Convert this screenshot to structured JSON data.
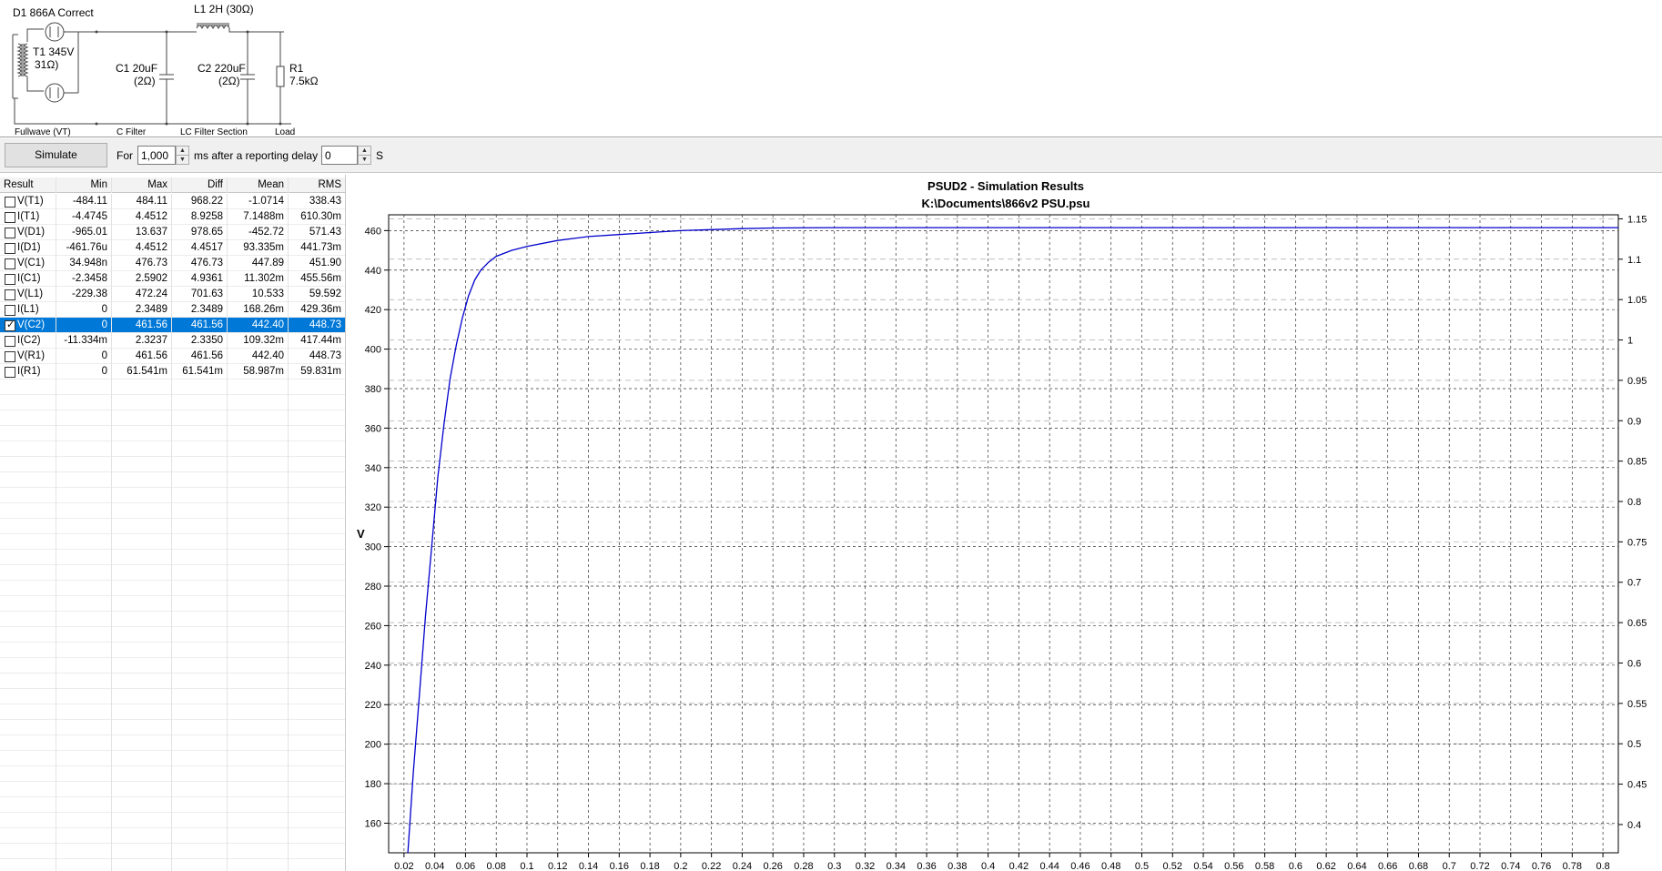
{
  "schematic": {
    "labels": {
      "d1": "D1 866A Correct",
      "l1": "L1 2H (30Ω)",
      "t1_line1": "T1 345V",
      "t1_line2": "31Ω)",
      "c1_line1": "C1 20uF",
      "c1_line2": "(2Ω)",
      "c2_line1": "C2 220uF",
      "c2_line2": "(2Ω)",
      "r1_line1": "R1",
      "r1_line2": "7.5kΩ"
    },
    "sections": {
      "fullwave": "Fullwave (VT)",
      "cfilter": "C Filter",
      "lcfilter": "LC Filter Section",
      "load": "Load"
    }
  },
  "toolbar": {
    "simulate_label": "Simulate",
    "for_label": "For",
    "duration_value": "1,000",
    "ms_label": "ms  after a reporting delay of",
    "delay_value": "0",
    "s_label": "S"
  },
  "results": {
    "headers": [
      "Result",
      "Min",
      "Max",
      "Diff",
      "Mean",
      "RMS"
    ],
    "rows": [
      {
        "name": "V(T1)",
        "min": "-484.11",
        "max": "484.11",
        "diff": "968.22",
        "mean": "-1.0714",
        "rms": "338.43",
        "checked": false
      },
      {
        "name": "I(T1)",
        "min": "-4.4745",
        "max": "4.4512",
        "diff": "8.9258",
        "mean": "7.1488m",
        "rms": "610.30m",
        "checked": false
      },
      {
        "name": "V(D1)",
        "min": "-965.01",
        "max": "13.637",
        "diff": "978.65",
        "mean": "-452.72",
        "rms": "571.43",
        "checked": false
      },
      {
        "name": "I(D1)",
        "min": "-461.76u",
        "max": "4.4512",
        "diff": "4.4517",
        "mean": "93.335m",
        "rms": "441.73m",
        "checked": false
      },
      {
        "name": "V(C1)",
        "min": "34.948n",
        "max": "476.73",
        "diff": "476.73",
        "mean": "447.89",
        "rms": "451.90",
        "checked": false
      },
      {
        "name": "I(C1)",
        "min": "-2.3458",
        "max": "2.5902",
        "diff": "4.9361",
        "mean": "11.302m",
        "rms": "455.56m",
        "checked": false
      },
      {
        "name": "V(L1)",
        "min": "-229.38",
        "max": "472.24",
        "diff": "701.63",
        "mean": "10.533",
        "rms": "59.592",
        "checked": false
      },
      {
        "name": "I(L1)",
        "min": "0",
        "max": "2.3489",
        "diff": "2.3489",
        "mean": "168.26m",
        "rms": "429.36m",
        "checked": false
      },
      {
        "name": "V(C2)",
        "min": "0",
        "max": "461.56",
        "diff": "461.56",
        "mean": "442.40",
        "rms": "448.73",
        "checked": true
      },
      {
        "name": "I(C2)",
        "min": "-11.334m",
        "max": "2.3237",
        "diff": "2.3350",
        "mean": "109.32m",
        "rms": "417.44m",
        "checked": false
      },
      {
        "name": "V(R1)",
        "min": "0",
        "max": "461.56",
        "diff": "461.56",
        "mean": "442.40",
        "rms": "448.73",
        "checked": false
      },
      {
        "name": "I(R1)",
        "min": "0",
        "max": "61.541m",
        "diff": "61.541m",
        "mean": "58.987m",
        "rms": "59.831m",
        "checked": false
      }
    ]
  },
  "chart_data": {
    "type": "line",
    "title": "PSUD2 - Simulation Results",
    "subtitle": "K:\\Documents\\866v2 PSU.psu",
    "ylabel": "V",
    "xlim": [
      0.01,
      0.81
    ],
    "ylim": [
      145,
      468
    ],
    "y2lim": [
      0.365,
      1.155
    ],
    "x_ticks": [
      0.02,
      0.04,
      0.06,
      0.08,
      0.1,
      0.12,
      0.14,
      0.16,
      0.18,
      0.2,
      0.22,
      0.24,
      0.26,
      0.28,
      0.3,
      0.32,
      0.34,
      0.36,
      0.38,
      0.4,
      0.42,
      0.44,
      0.46,
      0.48,
      0.5,
      0.52,
      0.54,
      0.56,
      0.58,
      0.6,
      0.62,
      0.64,
      0.66,
      0.68,
      0.7,
      0.72,
      0.74,
      0.76,
      0.78,
      0.8
    ],
    "y_ticks": [
      160,
      180,
      200,
      220,
      240,
      260,
      280,
      300,
      320,
      340,
      360,
      380,
      400,
      420,
      440,
      460
    ],
    "y2_ticks": [
      0.4,
      0.45,
      0.5,
      0.55,
      0.6,
      0.65,
      0.7,
      0.75,
      0.8,
      0.85,
      0.9,
      0.95,
      1,
      1.05,
      1.1,
      1.15
    ],
    "grid": true,
    "series": [
      {
        "color": "#0000cc",
        "x": [
          0.0225,
          0.026,
          0.03,
          0.034,
          0.038,
          0.042,
          0.046,
          0.05,
          0.054,
          0.058,
          0.062,
          0.066,
          0.07,
          0.075,
          0.08,
          0.09,
          0.1,
          0.12,
          0.14,
          0.16,
          0.18,
          0.2,
          0.22,
          0.24,
          0.26,
          0.3,
          0.4,
          0.5,
          0.6,
          0.7,
          0.8,
          0.81
        ],
        "y": [
          145,
          185,
          225,
          265,
          300,
          335,
          362,
          385,
          402,
          416,
          427,
          435,
          440,
          444,
          447,
          450,
          452,
          455,
          457,
          458,
          459,
          460,
          460.5,
          461,
          461.3,
          461.5,
          461.5,
          461.5,
          461.5,
          461.5,
          461.5,
          461.5
        ]
      }
    ]
  }
}
